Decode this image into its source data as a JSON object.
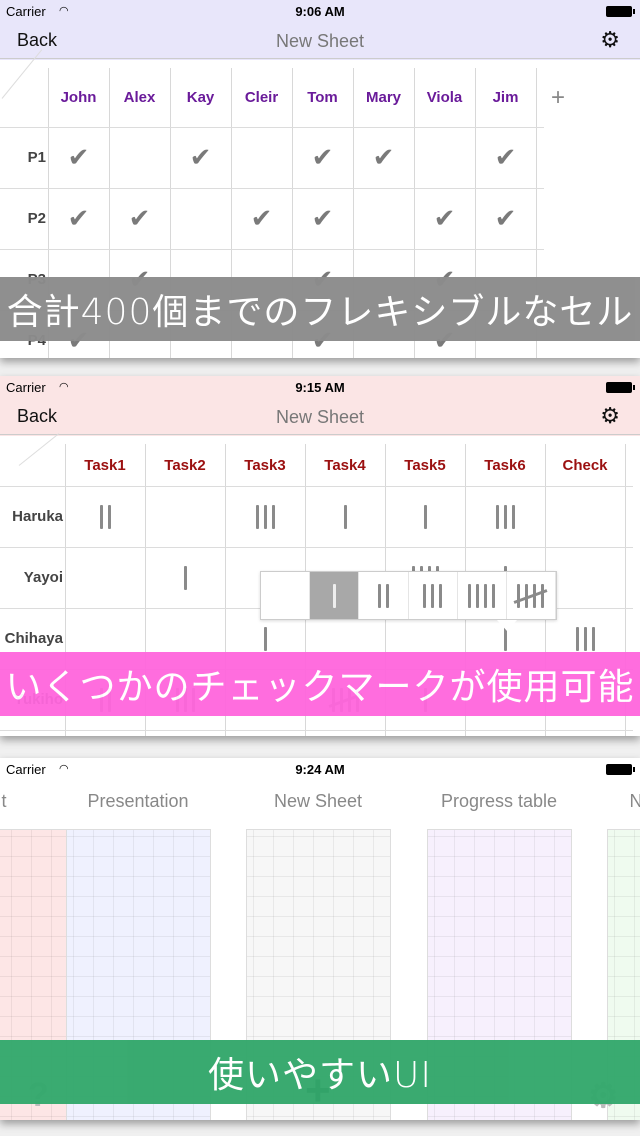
{
  "panels": [
    {
      "status": {
        "carrier": "Carrier",
        "time": "9:06 AM"
      },
      "nav": {
        "back": "Back",
        "title": "New Sheet",
        "settings_icon": "gears-icon"
      },
      "nav_color": "#e8e6fa",
      "header_color": "#6a1b9a",
      "columns": [
        "John",
        "Alex",
        "Kay",
        "Cleir",
        "Tom",
        "Mary",
        "Viola",
        "Jim"
      ],
      "add_column": "+",
      "rows": [
        {
          "label": "P1",
          "cells": [
            1,
            0,
            1,
            0,
            1,
            1,
            0,
            1
          ]
        },
        {
          "label": "P2",
          "cells": [
            1,
            1,
            0,
            1,
            1,
            0,
            1,
            1
          ]
        },
        {
          "label": "P3",
          "cells": [
            0,
            1,
            0,
            0,
            1,
            0,
            1,
            0
          ]
        },
        {
          "label": "P4",
          "cells": [
            1,
            0,
            0,
            0,
            1,
            0,
            1,
            0
          ]
        }
      ],
      "banner": {
        "text": "合計400個までのフレキシブルなセル",
        "color": "#8c8c8c"
      }
    },
    {
      "status": {
        "carrier": "Carrier",
        "time": "9:15 AM"
      },
      "nav": {
        "back": "Back",
        "title": "New Sheet",
        "settings_icon": "gears-icon"
      },
      "nav_color": "#fbe5e5",
      "header_color": "#9b1010",
      "columns": [
        "Task1",
        "Task2",
        "Task3",
        "Task4",
        "Task5",
        "Task6",
        "Check"
      ],
      "rows": [
        {
          "label": "Haruka",
          "cells": [
            2,
            0,
            3,
            1,
            1,
            3,
            0
          ]
        },
        {
          "label": "Yayoi",
          "cells": [
            0,
            1,
            0,
            0,
            4,
            1,
            0
          ]
        },
        {
          "label": "Chihaya",
          "cells": [
            0,
            0,
            1,
            0,
            0,
            1,
            3
          ]
        },
        {
          "label": "Yukiho",
          "cells": [
            2,
            3,
            0,
            5,
            1,
            0,
            0
          ]
        }
      ],
      "mark_picker": {
        "options": [
          0,
          1,
          2,
          3,
          4,
          5
        ],
        "selected": 1
      },
      "banner": {
        "text": "いくつかのチェックマークが使用可能",
        "color": "#ff66dd"
      }
    },
    {
      "status": {
        "carrier": "Carrier",
        "time": "9:24 AM"
      },
      "sheets": [
        {
          "title": "t",
          "color": "#fde6e6"
        },
        {
          "title": "Presentation",
          "color": "#eff1fe"
        },
        {
          "title": "New Sheet",
          "color": "#f7f7f7"
        },
        {
          "title": "Progress table",
          "color": "#f7f0fd"
        },
        {
          "title": "N",
          "color": "#effbef"
        }
      ],
      "toolbar": {
        "help": "?",
        "add": "+",
        "settings_icon": "gear-icon"
      },
      "banner": {
        "text": "使いやすいUI",
        "color": "#34a86c"
      }
    }
  ]
}
